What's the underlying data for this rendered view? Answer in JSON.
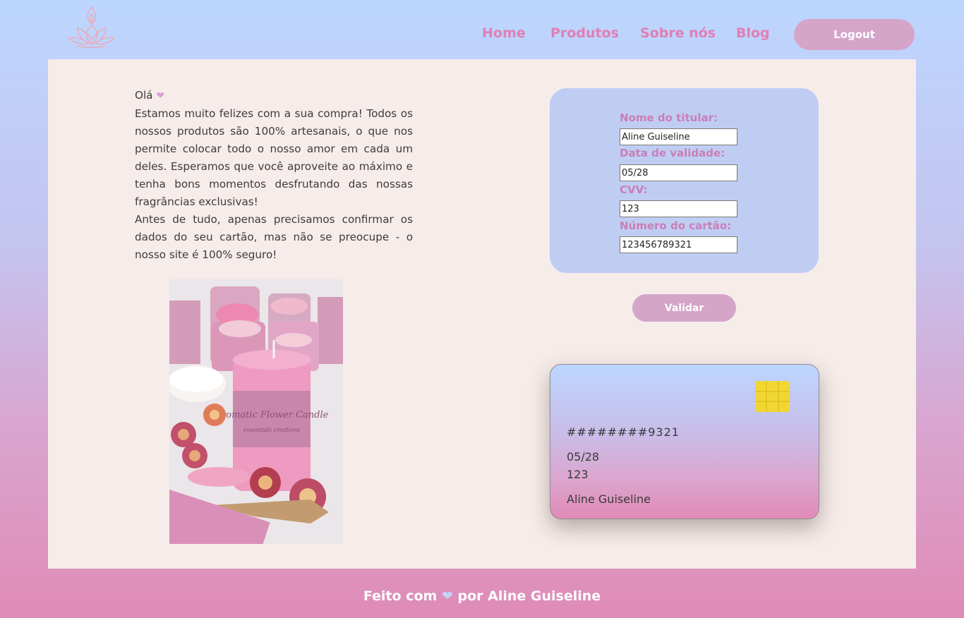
{
  "header": {
    "logo_icon": "lotus-candle-icon",
    "nav": [
      "Home",
      "Produtos",
      "Sobre nós",
      "Blog"
    ],
    "logout_label": "Logout"
  },
  "intro": {
    "greeting": "Olá",
    "greeting_icon": "heart-icon",
    "paragraph1": "Estamos muito felizes com a sua compra! Todos os nossos produtos são 100% artesanais, o que nos permite colocar todo o nosso amor em cada um deles. Esperamos que você aproveite ao máximo e tenha bons momentos desfrutando das nossas fragrâncias exclusivas!",
    "paragraph2": "Antes de tudo, apenas precisamos confirmar os dados do seu cartão, mas não se preocupe - o nosso site é 100% seguro!"
  },
  "photo": {
    "label_text": "Aromatic Flower Candle",
    "label_subtext": "essentials creations"
  },
  "form": {
    "holder_label": "Nome do titular:",
    "holder_value": "Aline Guiseline",
    "expiry_label": "Data de validade:",
    "expiry_value": "05/28",
    "cvv_label": "CVV:",
    "cvv_value": "123",
    "number_label": "Número do cartão:",
    "number_value": "123456789321",
    "validate_label": "Validar"
  },
  "card_preview": {
    "masked_number": "########9321",
    "expiry": "05/28",
    "cvv": "123",
    "holder": "Aline Guiseline",
    "chip_icon": "card-chip-icon"
  },
  "footer": {
    "prefix": "Feito com",
    "suffix": "por Aline Guiseline"
  },
  "colors": {
    "accent_pink": "#e07fb3",
    "button": "#d4a5c9",
    "panel": "#f6ecea",
    "form_bg": "#c0cdf3",
    "chip": "#f1d634"
  }
}
